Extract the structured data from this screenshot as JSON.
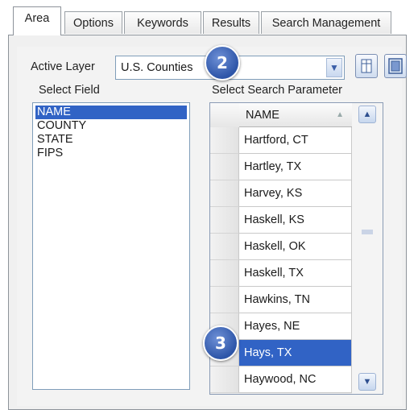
{
  "tabs": [
    "Area",
    "Options",
    "Keywords",
    "Results",
    "Search Management"
  ],
  "active_tab": "Area",
  "active_layer": {
    "label": "Active Layer",
    "value": "U.S. Counties"
  },
  "select_field": {
    "label": "Select Field",
    "items": [
      "NAME",
      "COUNTY",
      "STATE",
      "FIPS"
    ],
    "selected": "NAME"
  },
  "search_parameter": {
    "label": "Select Search Parameter",
    "column_header": "NAME",
    "rows": [
      "Hartford, CT",
      "Hartley, TX",
      "Harvey, KS",
      "Haskell, KS",
      "Haskell, OK",
      "Haskell, TX",
      "Hawkins, TN",
      "Hayes, NE",
      "Hays, TX",
      "Haywood, NC"
    ],
    "selected": "Hays, TX"
  },
  "callouts": [
    "2",
    "3"
  ],
  "icons": {
    "dropdown": "chevron-down-icon",
    "table": "table-icon",
    "grid": "grid-select-icon",
    "scroll_up": "chevron-up-icon",
    "scroll_down": "chevron-down-icon"
  },
  "colors": {
    "selection": "#3163c5",
    "callout": "#2d55a8"
  }
}
